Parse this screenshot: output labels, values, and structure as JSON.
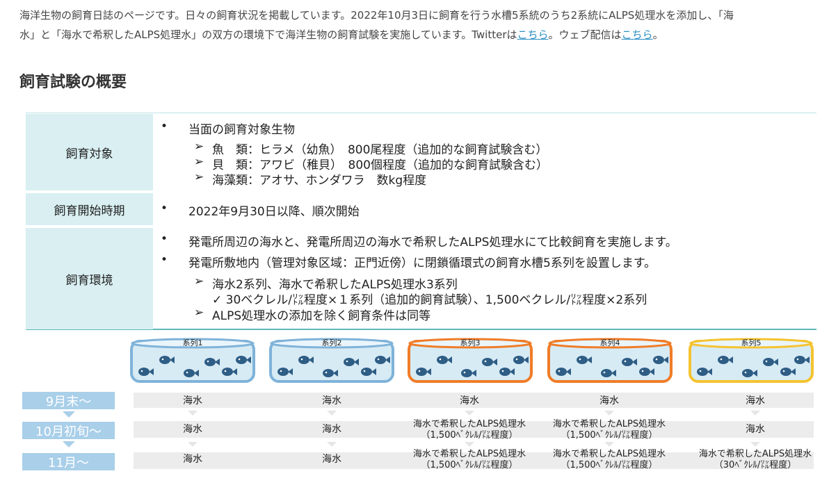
{
  "intro": {
    "text1": "海洋生物の飼育日誌のページです。日々の飼育状況を掲載しています。2022年10月3日に飼育を行う水槽5系統のうち2系統にALPS処理水を添加し、「海",
    "text2a": "水」と「海水で希釈したALPS処理水」の双方の環境下で海洋生物の飼育試験を実施しています。Twitterは",
    "twitter_link": "こちら",
    "text2b": "。ウェブ配信は",
    "web_link": "こちら",
    "text2c": "。"
  },
  "section_title": "飼育試験の概要",
  "overview": {
    "rows": [
      {
        "head": "飼育対象",
        "lines": [
          {
            "bullet": "•",
            "text": "当面の飼育対象生物"
          },
          {
            "bullet": "➢",
            "text": "魚　類：ヒラメ（幼魚）　800尾程度（追加的な飼育試験含む）"
          },
          {
            "bullet": "➢",
            "text": "貝　類：アワビ（稚貝）　800個程度（追加的な飼育試験含む）"
          },
          {
            "bullet": "➢",
            "text": "海藻類：アオサ、ホンダワラ　数kg程度"
          }
        ]
      },
      {
        "head": "飼育開始時期",
        "lines": [
          {
            "bullet": "•",
            "text": "2022年9月30日以降、順次開始"
          }
        ]
      },
      {
        "head": "飼育環境",
        "lines": [
          {
            "bullet": "•",
            "text": "発電所周辺の海水と、発電所周辺の海水で希釈したALPS処理水にて比較飼育を実施します。"
          },
          {
            "bullet": "•",
            "text": "発電所敷地内（管理対象区域：正門近傍）に閉鎖循環式の飼育水槽5系列を設置します。"
          },
          {
            "bullet": "➢",
            "text": "海水2系列、海水で希釈したALPS処理水3系列"
          },
          {
            "bullet": "",
            "text": "✓ 30ベクレル/㍑程度×１系列（追加的飼育試験）、1,500ベクレル/㍑程度×2系列"
          },
          {
            "bullet": "➢",
            "text": "ALPS処理水の添加を除く飼育条件は同等"
          }
        ]
      }
    ]
  },
  "tanks": [
    {
      "label": "系列1",
      "color": "#7fb3d9"
    },
    {
      "label": "系列2",
      "color": "#7fb3d9"
    },
    {
      "label": "系列3",
      "color": "#f07c28"
    },
    {
      "label": "系列4",
      "color": "#f07c28"
    },
    {
      "label": "系列5",
      "color": "#f5c330"
    }
  ],
  "timeline": {
    "periods": [
      "9月末～",
      "10月初旬～",
      "11月～"
    ],
    "rows": [
      [
        [
          "海水"
        ],
        [
          "海水"
        ],
        [
          "海水"
        ],
        [
          "海水"
        ],
        [
          "海水"
        ]
      ],
      [
        [
          "海水"
        ],
        [
          "海水"
        ],
        [
          "海水で希釈したALPS処理水",
          "（1,500ﾍﾞｸﾚﾙ/㍑程度）"
        ],
        [
          "海水で希釈したALPS処理水",
          "（1,500ﾍﾞｸﾚﾙ/㍑程度）"
        ],
        [
          "海水"
        ]
      ],
      [
        [
          "海水"
        ],
        [
          "海水"
        ],
        [
          "海水で希釈したALPS処理水",
          "（1,500ﾍﾞｸﾚﾙ/㍑程度）"
        ],
        [
          "海水で希釈したALPS処理水",
          "（1,500ﾍﾞｸﾚﾙ/㍑程度）"
        ],
        [
          "海水で希釈したALPS処理水",
          "（30ﾍﾞｸﾚﾙ/㍑程度）"
        ]
      ]
    ]
  }
}
